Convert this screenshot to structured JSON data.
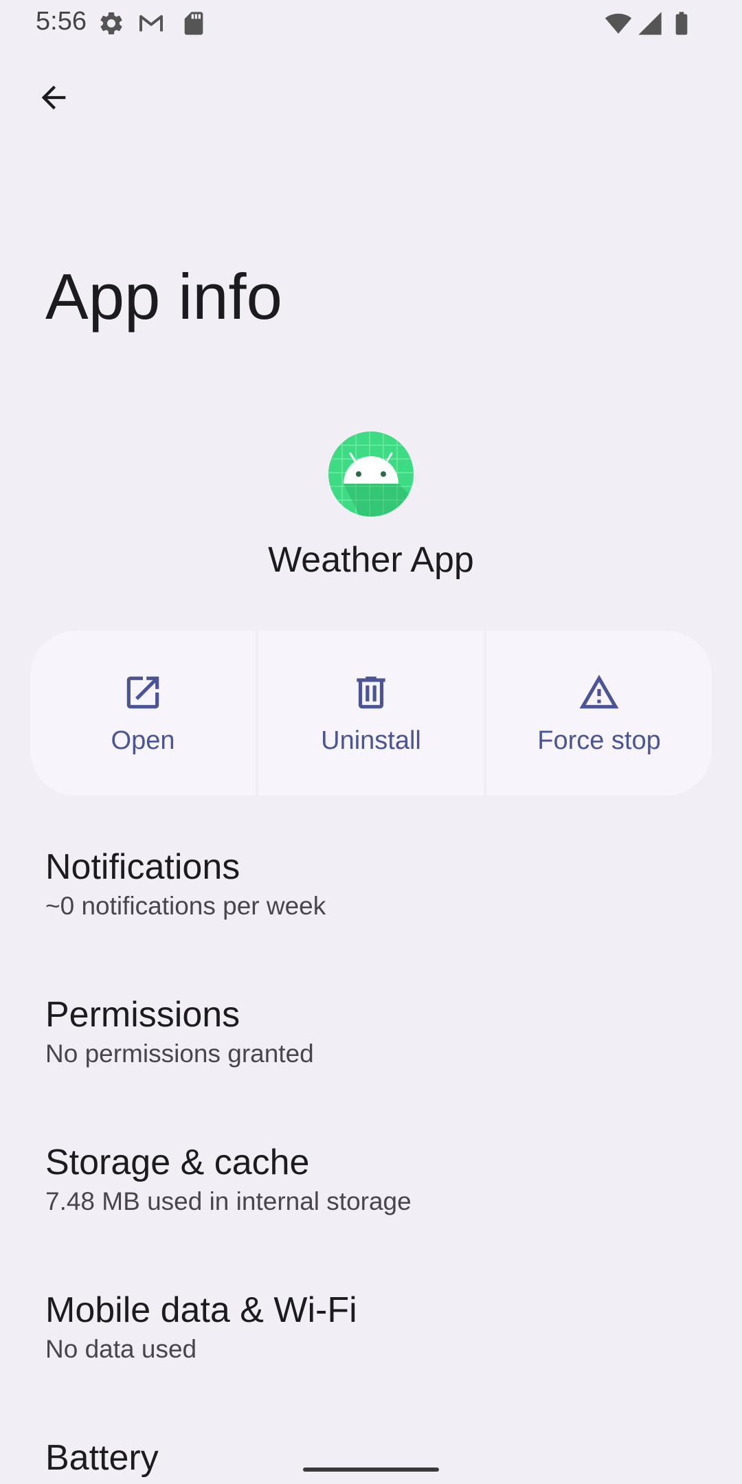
{
  "status_bar": {
    "time": "5:56",
    "icons": [
      "settings-icon",
      "gmail-icon",
      "sd-card-icon",
      "wifi-icon",
      "cell-signal-icon",
      "battery-icon"
    ]
  },
  "header": {
    "back_icon": "arrow-back-icon",
    "title": "App info"
  },
  "app": {
    "icon": "android-app-icon",
    "name": "Weather App"
  },
  "actions": [
    {
      "label": "Open",
      "icon": "open-external-icon"
    },
    {
      "label": "Uninstall",
      "icon": "trash-icon"
    },
    {
      "label": "Force stop",
      "icon": "warning-icon"
    }
  ],
  "settings": [
    {
      "title": "Notifications",
      "subtitle": "~0 notifications per week"
    },
    {
      "title": "Permissions",
      "subtitle": "No permissions granted"
    },
    {
      "title": "Storage & cache",
      "subtitle": "7.48 MB used in internal storage"
    },
    {
      "title": "Mobile data & Wi-Fi",
      "subtitle": "No data used"
    },
    {
      "title": "Battery",
      "subtitle": ""
    }
  ],
  "colors": {
    "background": "#f1eff5",
    "action_tint": "#4a5497",
    "app_icon_green": "#3ddc84"
  }
}
